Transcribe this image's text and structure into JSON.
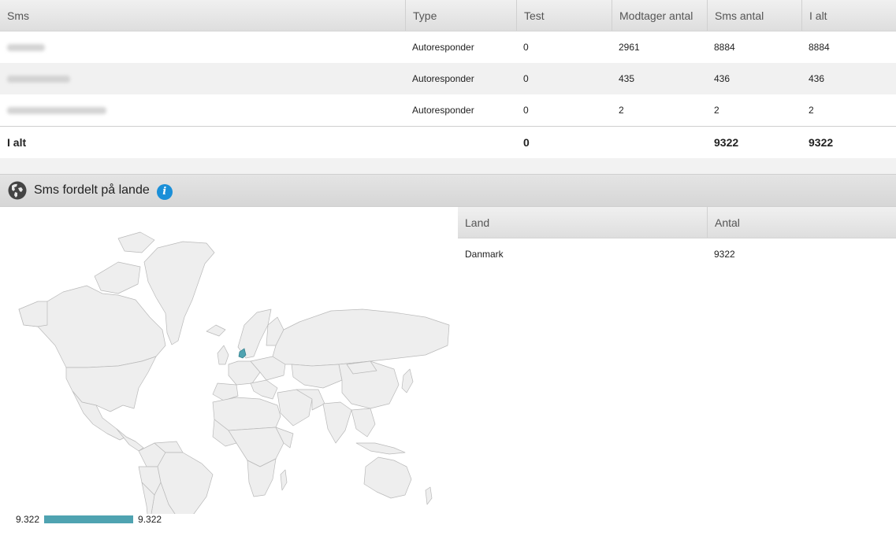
{
  "sms_table": {
    "headers": [
      "Sms",
      "Type",
      "Test",
      "Modtager antal",
      "Sms antal",
      "I alt"
    ],
    "rows": [
      {
        "type": "Autoresponder",
        "test": "0",
        "recipients": "2961",
        "sms_count": "8884",
        "total": "8884"
      },
      {
        "type": "Autoresponder",
        "test": "0",
        "recipients": "435",
        "sms_count": "436",
        "total": "436"
      },
      {
        "type": "Autoresponder",
        "test": "0",
        "recipients": "2",
        "sms_count": "2",
        "total": "2"
      }
    ],
    "footer": {
      "label": "I alt",
      "test": "0",
      "sms_count": "9322",
      "total": "9322"
    }
  },
  "section": {
    "title": "Sms fordelt på lande",
    "icon": "globe-icon",
    "info_icon": "info-icon",
    "info_glyph": "i"
  },
  "map": {
    "highlight_color": "#4fa3b1",
    "land_color": "#eeeeee",
    "highlighted_country": "Danmark",
    "legend_min": "9.322",
    "legend_max": "9.322"
  },
  "country_table": {
    "headers": [
      "Land",
      "Antal"
    ],
    "rows": [
      {
        "country": "Danmark",
        "count": "9322"
      }
    ]
  }
}
